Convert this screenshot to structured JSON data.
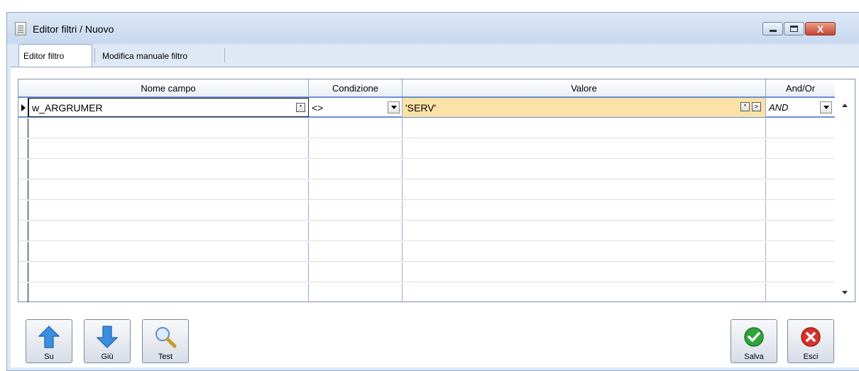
{
  "window": {
    "title": "Editor filtri / Nuovo",
    "controls": {
      "minimize": "_",
      "maximize": "□",
      "close": "X"
    }
  },
  "tabs": [
    {
      "label": "Editor filtro",
      "active": true
    },
    {
      "label": "Modifica manuale filtro",
      "active": false
    }
  ],
  "grid": {
    "columns": [
      "Nome campo",
      "Condizione",
      "Valore",
      "And/Or"
    ],
    "rows": [
      {
        "nome": "w_ARGRUMER",
        "condizione": "<>",
        "valore": "'SERV'",
        "andor": "AND"
      }
    ],
    "empty_row_count": 9,
    "mini_button_glyph": "*",
    "next_glyph": ">"
  },
  "buttons": {
    "su": "Su",
    "giu": "Giù",
    "test": "Test",
    "salva": "Salva",
    "esci": "Esci"
  },
  "colors": {
    "selected_value_bg": "#fbe3a7",
    "save_green": "#2ea43a",
    "exit_red": "#d8322a",
    "arrow_blue": "#3a8fe0"
  }
}
